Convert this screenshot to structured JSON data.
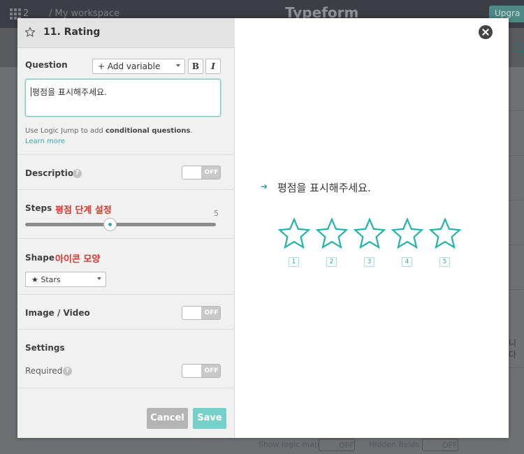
{
  "background": {
    "workspace_count": "2",
    "breadcrumb": "/ My workspace",
    "brand": "Typeform",
    "upgrade_label": "Upgra",
    "right_edge_text": "니다",
    "footer_show_logic": "Show logic map",
    "footer_off_1": "OFF",
    "footer_hidden_fields": "Hidden fields",
    "footer_off_2": "OFF"
  },
  "editor": {
    "header_icon": "star-outline-icon",
    "title": "11. Rating",
    "question": {
      "label": "Question",
      "add_variable_label": "+ Add variable",
      "bold_label": "B",
      "italic_label": "I",
      "value": "평점을 표시해주세요.",
      "hint_prefix": "Use Logic Jump to add ",
      "hint_bold": "conditional questions",
      "hint_suffix": ".",
      "learn_more": "Learn more"
    },
    "description": {
      "label": "Description",
      "help": "?",
      "toggle": "OFF"
    },
    "steps": {
      "label": "Steps",
      "annotation": "평점 단계 설정",
      "value": 5,
      "value_label": "5",
      "min": 1,
      "max": 10
    },
    "shape": {
      "label": "Shape",
      "annotation": "아이콘 모양",
      "selected": "★ Stars"
    },
    "image_video": {
      "label": "Image / Video",
      "toggle": "OFF"
    },
    "settings": {
      "label": "Settings",
      "required_label": "Required",
      "help": "?",
      "required_toggle": "OFF"
    },
    "cancel_label": "Cancel",
    "save_label": "Save"
  },
  "preview": {
    "arrow": "➔",
    "question": "평점을 표시해주세요.",
    "rating_count": 5,
    "rating_labels": [
      "1",
      "2",
      "3",
      "4",
      "5"
    ],
    "star_color": "#1fb3aa"
  },
  "colors": {
    "accent": "#3aa6a1",
    "annotation_red": "#e0322a",
    "save_button": "#77cfca"
  }
}
